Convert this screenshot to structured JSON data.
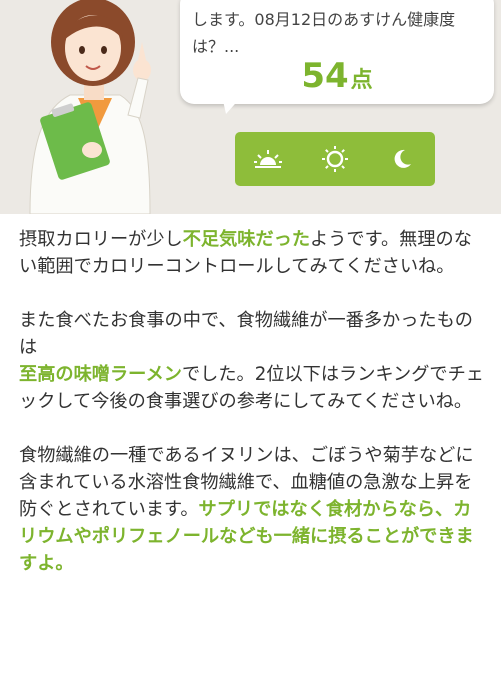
{
  "header": {
    "bubble_text": "します。08月12日のあすけん健康度\nは？...",
    "score_value": "54",
    "score_unit": "点",
    "time_icons": [
      "sunrise-icon",
      "sun-icon",
      "moon-icon"
    ],
    "colors": {
      "accent": "#7db42e",
      "bar": "#8ebd3a",
      "header_bg": "#ece9e4"
    }
  },
  "advice": {
    "p1": {
      "a": "摂取カロリーが少し",
      "b": "不足気味だった",
      "c": "ようです。無理のない範囲でカロリーコントロールしてみてくださいね。"
    },
    "p2": {
      "a": "また食べたお食事の中で、食物繊維が一番多かったものは",
      "b": "至高の味噌ラーメン",
      "c": "でした。2位以下はランキングでチェックして今後の食事選びの参考にしてみてくださいね。"
    },
    "p3": {
      "a": "食物繊維の一種であるイヌリンは、ごぼうや菊芋などに含まれている水溶性食物繊維で、血糖値の急激な上昇を防ぐとされています。",
      "b": "サプリではなく食材からなら、カリウムやポリフェノールなども一緒に摂ることができますよ。"
    }
  }
}
